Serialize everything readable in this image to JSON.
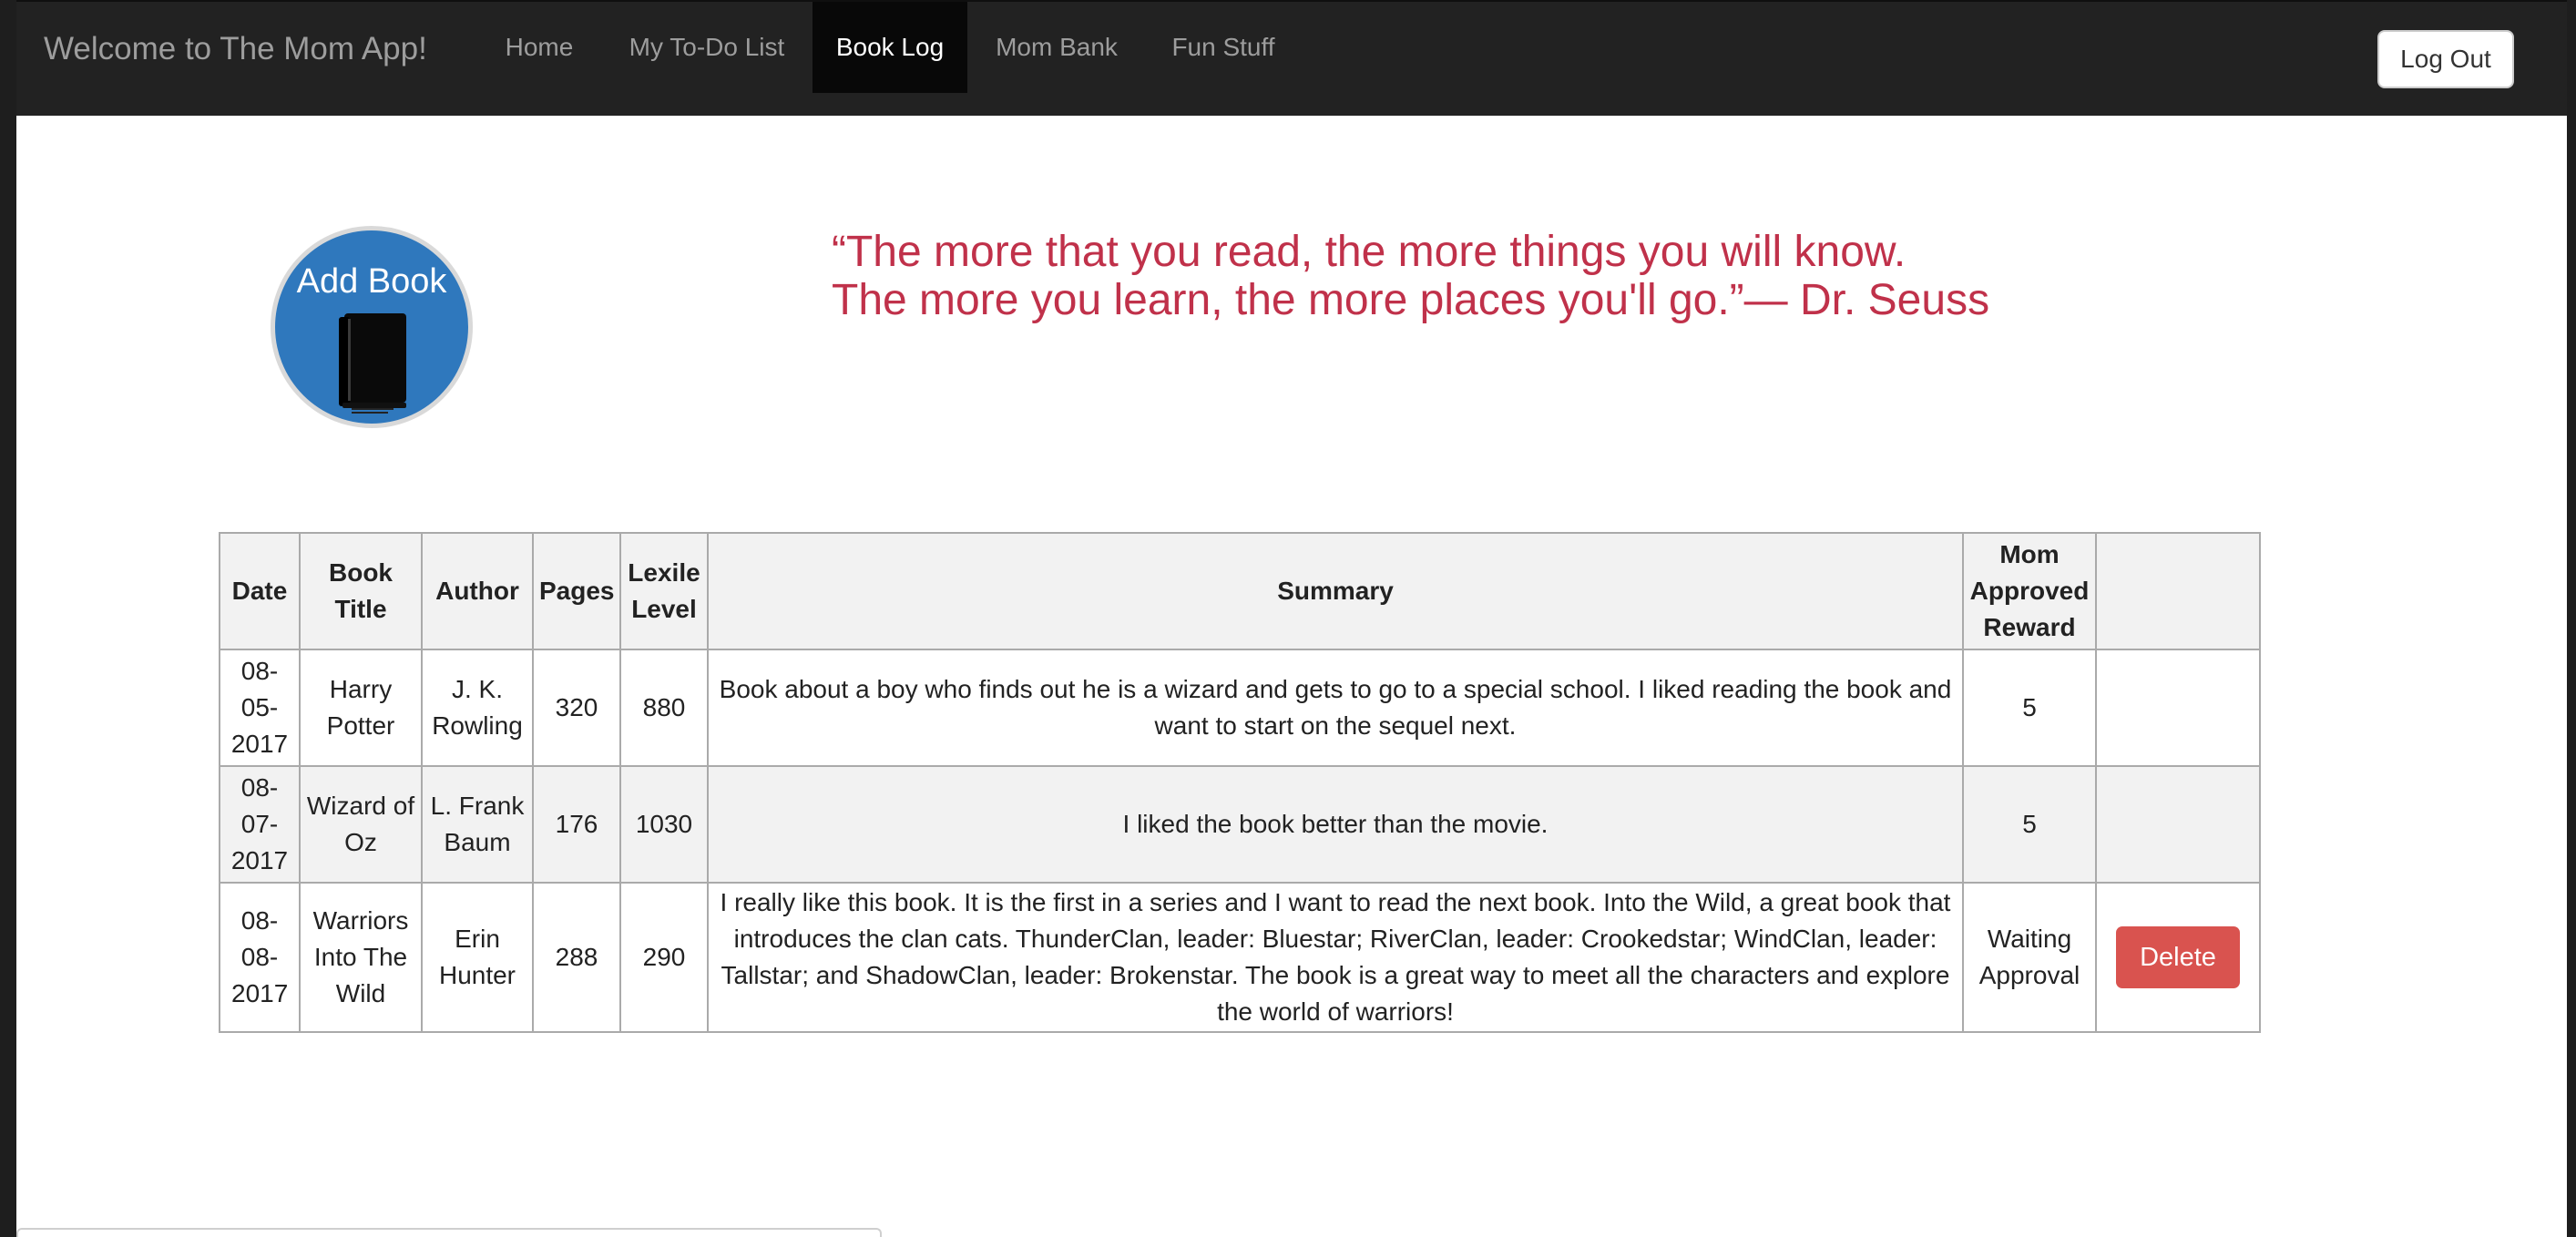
{
  "navbar": {
    "brand": "Welcome to The Mom App!",
    "items": [
      {
        "label": "Home",
        "active": false
      },
      {
        "label": "My To-Do List",
        "active": false
      },
      {
        "label": "Book Log",
        "active": true
      },
      {
        "label": "Mom Bank",
        "active": false
      },
      {
        "label": "Fun Stuff",
        "active": false
      }
    ],
    "logout_label": "Log Out"
  },
  "add_book": {
    "label": "Add Book",
    "icon": "book-icon"
  },
  "quote": {
    "line1": "“The more that you read, the more things you will know.",
    "line2": "The more you learn, the more places you'll go.”— Dr. Seuss"
  },
  "table": {
    "headers": [
      "Date",
      "Book Title",
      "Author",
      "Pages",
      "Lexile Level",
      "Summary",
      "Mom Approved Reward",
      ""
    ],
    "rows": [
      {
        "date": "08-05-2017",
        "title": "Harry Potter",
        "author": "J. K. Rowling",
        "pages": "320",
        "lexile": "880",
        "summary": "Book about a boy who finds out he is a wizard and gets to go to a special school. I liked reading the book and want to start on the sequel next.",
        "reward": "5",
        "action": ""
      },
      {
        "date": "08-07-2017",
        "title": "Wizard of Oz",
        "author": "L. Frank Baum",
        "pages": "176",
        "lexile": "1030",
        "summary": "I liked the book better than the movie.",
        "reward": "5",
        "action": ""
      },
      {
        "date": "08-08-2017",
        "title": "Warriors Into The Wild",
        "author": "Erin Hunter",
        "pages": "288",
        "lexile": "290",
        "summary": "I really like this book. It is the first in a series and I want to read the next book. Into the Wild, a great book that introduces the clan cats. ThunderClan, leader: Bluestar; RiverClan, leader: Crookedstar; WindClan, leader: Tallstar; and ShadowClan, leader: Brokenstar. The book is a great way to meet all the characters and explore the world of warriors!",
        "reward": "Waiting Approval",
        "action": "Delete"
      }
    ]
  },
  "colors": {
    "navbar_bg": "#222222",
    "quote": "#c0314a",
    "add_book_bg": "#2f78bd",
    "delete_bg": "#d9534f"
  }
}
